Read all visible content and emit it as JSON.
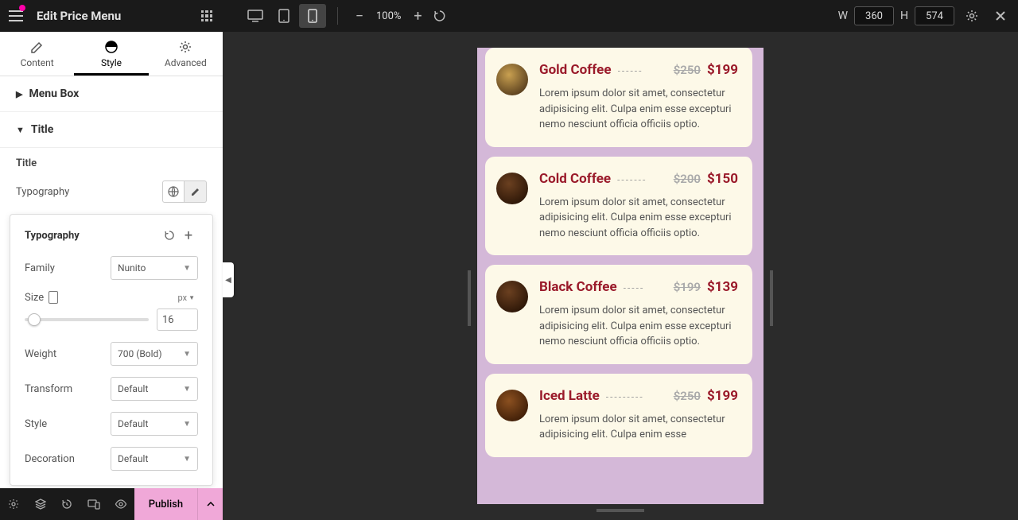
{
  "header": {
    "title": "Edit Price Menu",
    "zoom": "100%",
    "width_label": "W",
    "width_value": "360",
    "height_label": "H",
    "height_value": "574"
  },
  "tabs": {
    "content": "Content",
    "style": "Style",
    "advanced": "Advanced"
  },
  "sections": {
    "menu_box": "Menu Box",
    "title": "Title"
  },
  "panel": {
    "title_label": "Title",
    "typography_label": "Typography"
  },
  "typo": {
    "heading": "Typography",
    "family_label": "Family",
    "family_value": "Nunito",
    "size_label": "Size",
    "size_unit": "px",
    "size_value": "16",
    "weight_label": "Weight",
    "weight_value": "700 (Bold)",
    "transform_label": "Transform",
    "transform_value": "Default",
    "style_label": "Style",
    "style_value": "Default",
    "decoration_label": "Decoration",
    "decoration_value": "Default"
  },
  "bottombar": {
    "publish": "Publish"
  },
  "menu_items": [
    {
      "name": "Gold Coffee",
      "old": "$250",
      "new": "$199",
      "desc": "Lorem ipsum dolor sit amet, consectetur adipisicing elit. Culpa enim esse excepturi nemo nesciunt officia officiis optio."
    },
    {
      "name": "Cold Coffee",
      "old": "$200",
      "new": "$150",
      "desc": "Lorem ipsum dolor sit amet, consectetur adipisicing elit. Culpa enim esse excepturi nemo nesciunt officia officiis optio."
    },
    {
      "name": "Black Coffee",
      "old": "$199",
      "new": "$139",
      "desc": "Lorem ipsum dolor sit amet, consectetur adipisicing elit. Culpa enim esse excepturi nemo nesciunt officia officiis optio."
    },
    {
      "name": "Iced Latte",
      "old": "$250",
      "new": "$199",
      "desc": "Lorem ipsum dolor sit amet, consectetur adipisicing elit. Culpa enim esse"
    }
  ]
}
